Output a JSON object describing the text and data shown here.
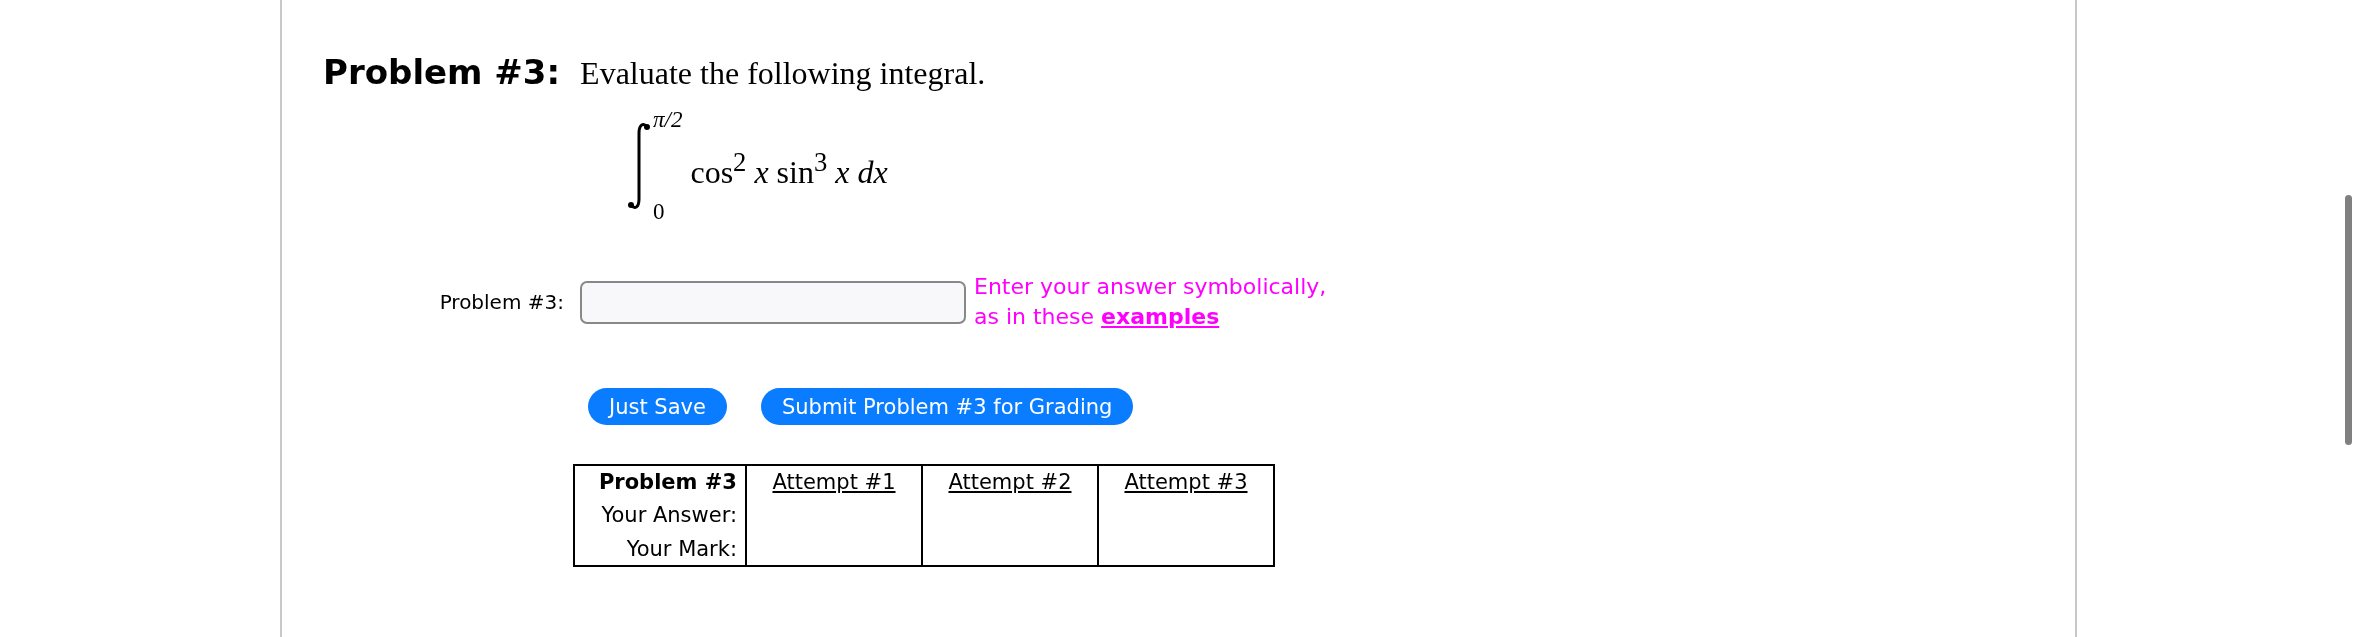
{
  "problem": {
    "heading": "Problem #3:",
    "prompt": "Evaluate the following integral.",
    "integral": {
      "upper": "π/2",
      "lower": "0",
      "integrand": "cos$^{2}$ *x* sin$^{3}$ *x* *dx*"
    }
  },
  "answer": {
    "label": "Problem #3:",
    "hint": "Enter your answer symbolically, as in these",
    "hint_link": "examples"
  },
  "buttons": [
    "Just Save",
    "Submit Problem #3 for Grading"
  ],
  "table": {
    "columns": [
      "Problem #3",
      "Attempt #1",
      "Attempt #2",
      "Attempt #3"
    ],
    "rows": [
      {
        "label": "Your Answer:"
      },
      {
        "label": "Your Mark:"
      }
    ]
  }
}
